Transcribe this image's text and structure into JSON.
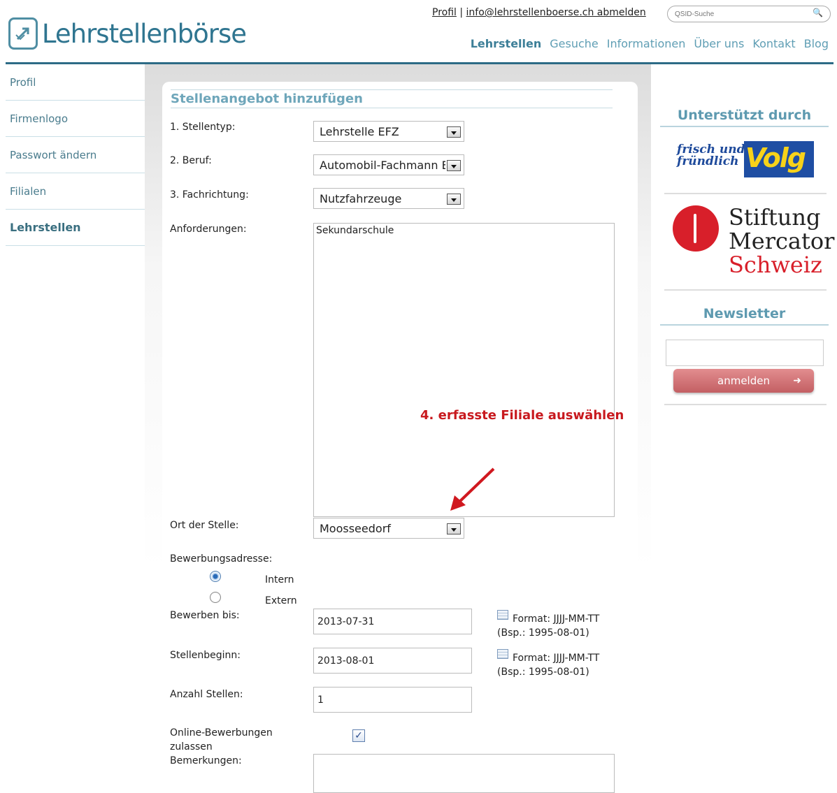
{
  "header": {
    "logo_text": "Lehrstellenbörse",
    "profile_link": "Profil",
    "separator": "|",
    "email_link": "info@lehrstellenboerse.ch abmelden",
    "search_placeholder": "QSID-Suche",
    "nav": [
      "Lehrstellen",
      "Gesuche",
      "Informationen",
      "Über uns",
      "Kontakt",
      "Blog"
    ],
    "active_nav": "Lehrstellen"
  },
  "sidebar": {
    "items": [
      {
        "label": "Profil"
      },
      {
        "label": "Firmenlogo"
      },
      {
        "label": "Passwort ändern"
      },
      {
        "label": "Filialen"
      },
      {
        "label": "Lehrstellen"
      }
    ],
    "active": "Lehrstellen"
  },
  "form": {
    "title": "Stellenangebot hinzufügen",
    "stellentyp": {
      "label": "1. Stellentyp:",
      "value": "Lehrstelle EFZ"
    },
    "beruf": {
      "label": "2. Beruf:",
      "value": "Automobil-Fachmann EFZ"
    },
    "fachrichtung": {
      "label": "3. Fachrichtung:",
      "value": "Nutzfahrzeuge"
    },
    "anforderungen": {
      "label": "Anforderungen:",
      "value": "Sekundarschule"
    },
    "ort": {
      "label": "Ort der Stelle:",
      "value": "Moosseedorf"
    },
    "bewerbungsadresse": {
      "label": "Bewerbungsadresse:",
      "options": [
        "Intern",
        "Extern"
      ],
      "selected": "Intern"
    },
    "bewerben_bis": {
      "label": "Bewerben bis:",
      "value": "2013-07-31",
      "hint_format": "Format: JJJJ-MM-TT",
      "hint_example": "(Bsp.: 1995-08-01)"
    },
    "stellenbeginn": {
      "label": "Stellenbeginn:",
      "value": "2013-08-01",
      "hint_format": "Format: JJJJ-MM-TT",
      "hint_example": "(Bsp.: 1995-08-01)"
    },
    "anzahl": {
      "label": "Anzahl Stellen:",
      "value": "1"
    },
    "online": {
      "label_line1": "Online-Bewerbungen",
      "label_line2": "zulassen",
      "checked": true
    },
    "bemerkungen": {
      "label": "Bemerkungen:",
      "value": ""
    }
  },
  "annotation": {
    "text": "4. erfasste Filiale auswählen",
    "color": "#c8191e"
  },
  "right": {
    "supported_heading": "Unterstützt durch",
    "volg_slogan_1": "frisch und",
    "volg_slogan_2": "fründlich",
    "volg_brand": "Volg",
    "mercator_1": "Stiftung",
    "mercator_2": "Mercator",
    "mercator_3": "Schweiz",
    "newsletter_heading": "Newsletter",
    "newsletter_button": "anmelden"
  },
  "colors": {
    "brand": "#2f7590",
    "link_blue": "#5f9eb4",
    "header_rule": "#2d6b86",
    "button_red": "#c35f63"
  }
}
